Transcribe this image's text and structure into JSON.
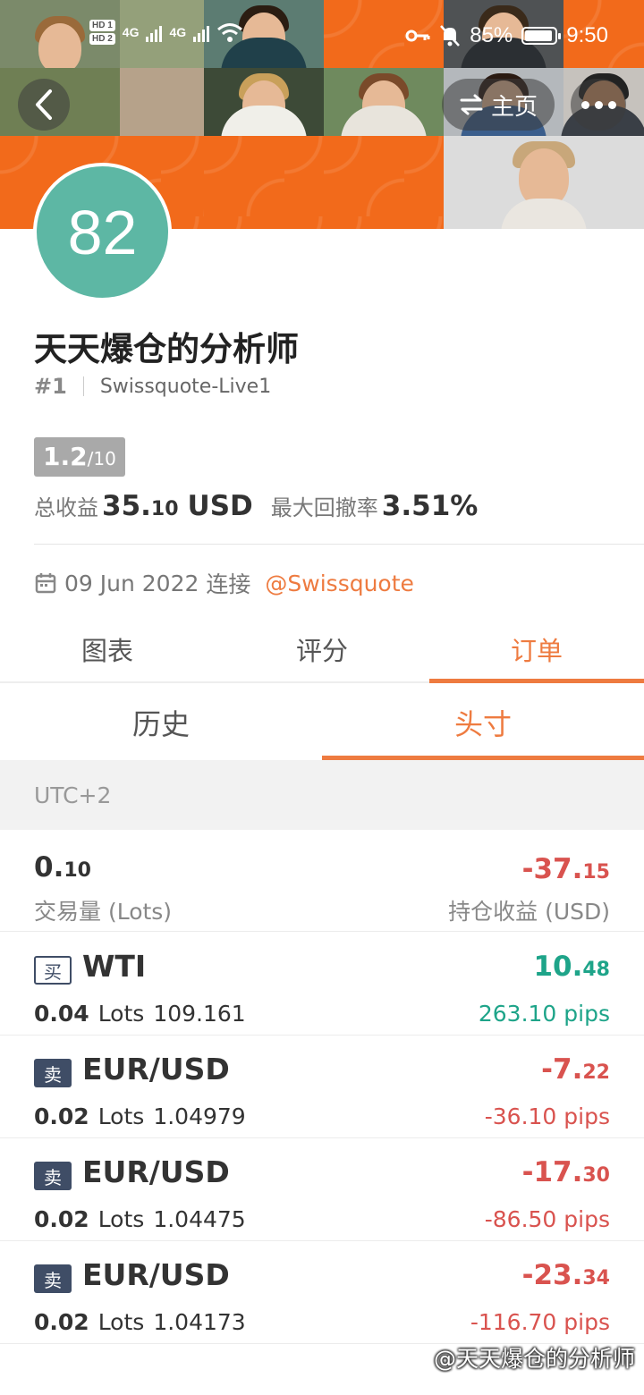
{
  "status_bar": {
    "hd1": "HD 1",
    "hd2": "HD 2",
    "net1": "4G",
    "net2": "4G",
    "battery": "85%",
    "time": "9:50"
  },
  "nav": {
    "home_label": "主页"
  },
  "profile": {
    "score": "82",
    "name": "天天爆仓的分析师",
    "rank": "#1",
    "account": "Swissquote-Live1",
    "rating_main": "1.2",
    "rating_scale": "/10",
    "total_profit_label": "总收益",
    "total_profit_int": "35.",
    "total_profit_dec": "10",
    "total_profit_unit": "USD",
    "max_drawdown_label": "最大回撤率",
    "max_drawdown": "3.51%",
    "connect_date": "09 Jun 2022",
    "connect_label": "连接",
    "broker_link": "@Swissquote"
  },
  "tabs": [
    "图表",
    "评分",
    "订单"
  ],
  "subtabs": [
    "历史",
    "头寸"
  ],
  "timezone": "UTC+2",
  "summary": {
    "volume_int": "0.",
    "volume_dec": "10",
    "volume_label": "交易量 (Lots)",
    "pnl_int": "-37.",
    "pnl_dec": "15",
    "pnl_label": "持仓收益 (USD)"
  },
  "positions": [
    {
      "side": "买",
      "side_type": "buy",
      "symbol": "WTI",
      "lots": "0.04",
      "lots_unit": "Lots",
      "price": "109.161",
      "pl_int": "10.",
      "pl_dec": "48",
      "pips": "263.10 pips",
      "tone": "green"
    },
    {
      "side": "卖",
      "side_type": "sell",
      "symbol": "EUR/USD",
      "lots": "0.02",
      "lots_unit": "Lots",
      "price": "1.04979",
      "pl_int": "-7.",
      "pl_dec": "22",
      "pips": "-36.10 pips",
      "tone": "red"
    },
    {
      "side": "卖",
      "side_type": "sell",
      "symbol": "EUR/USD",
      "lots": "0.02",
      "lots_unit": "Lots",
      "price": "1.04475",
      "pl_int": "-17.",
      "pl_dec": "30",
      "pips": "-86.50 pips",
      "tone": "red"
    },
    {
      "side": "卖",
      "side_type": "sell",
      "symbol": "EUR/USD",
      "lots": "0.02",
      "lots_unit": "Lots",
      "price": "1.04173",
      "pl_int": "-23.",
      "pl_dec": "34",
      "pips": "-116.70 pips",
      "tone": "red"
    }
  ],
  "watermark": "@天天爆仓的分析师",
  "colors": {
    "accent": "#ee7b40",
    "score_bg": "#5db7a4",
    "profit": "#1ea489",
    "loss": "#d9534f",
    "banner_orange": "#f26a1b"
  }
}
